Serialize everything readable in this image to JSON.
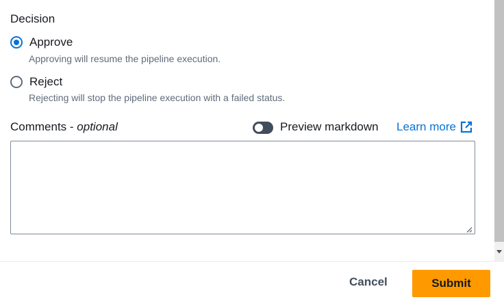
{
  "decision": {
    "legend": "Decision",
    "options": [
      {
        "label": "Approve",
        "description": "Approving will resume the pipeline execution.",
        "checked": true
      },
      {
        "label": "Reject",
        "description": "Rejecting will stop the pipeline execution with a failed status.",
        "checked": false
      }
    ]
  },
  "comments": {
    "label": "Comments - ",
    "optional": "optional",
    "value": "",
    "toggle_label": "Preview markdown",
    "toggle_on": false,
    "learn_more": "Learn more",
    "learn_more_icon": "external-link-icon"
  },
  "footer": {
    "cancel_label": "Cancel",
    "submit_label": "Submit"
  },
  "colors": {
    "accent": "#0972d3",
    "primary_button": "#ff9900",
    "toggle_off": "#414d5c"
  }
}
